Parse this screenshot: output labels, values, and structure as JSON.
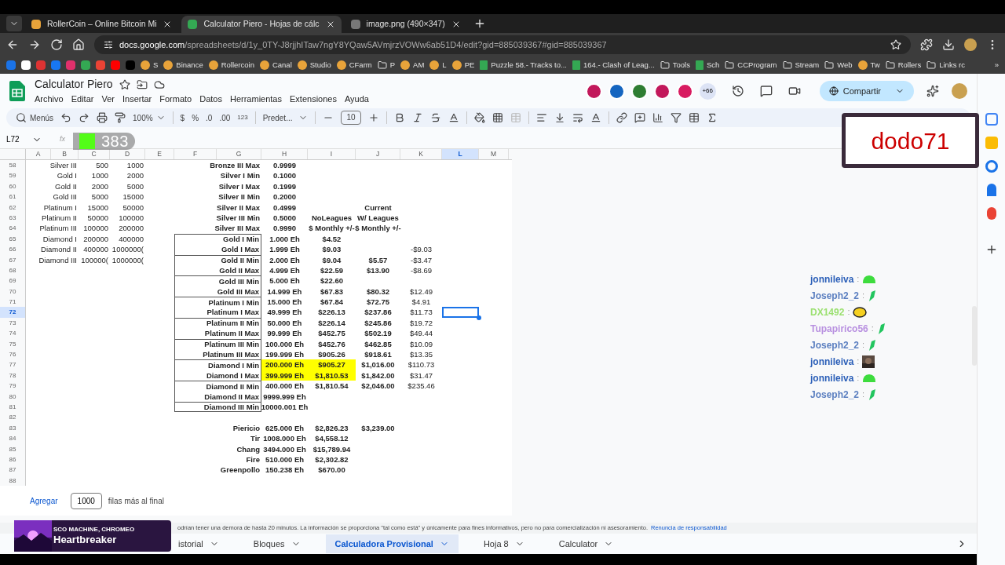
{
  "browser": {
    "tabs": [
      {
        "title": "RollerCoin – Online Bitcoin Mi",
        "selected": false
      },
      {
        "title": "Calculator Piero - Hojas de cálc",
        "selected": true
      },
      {
        "title": "image.png (490×347)",
        "selected": false
      }
    ],
    "address": {
      "host": "docs.google.com",
      "path": "/spreadsheets/d/1y_0TY-J8rjjhITaw7ngY8YQaw5AVmjrzVOWw6ab51D4/edit?gid=885039367#gid=885039367"
    },
    "bookmarks": [
      {
        "label": "S",
        "kind": "site"
      },
      {
        "label": "Binance",
        "kind": "site"
      },
      {
        "label": "Rollercoin",
        "kind": "site"
      },
      {
        "label": "Canal",
        "kind": "site"
      },
      {
        "label": "Studio",
        "kind": "site"
      },
      {
        "label": "CFarm",
        "kind": "site"
      },
      {
        "label": "P",
        "kind": "folder"
      },
      {
        "label": "AM",
        "kind": "site"
      },
      {
        "label": "L",
        "kind": "site"
      },
      {
        "label": "PE",
        "kind": "site"
      },
      {
        "label": "Puzzle 58.- Tracks to...",
        "kind": "sheet"
      },
      {
        "label": "164.- Clash of Leag...",
        "kind": "sheet"
      },
      {
        "label": "Tools",
        "kind": "folder"
      },
      {
        "label": "Sch",
        "kind": "sheet"
      },
      {
        "label": "CCProgram",
        "kind": "folder"
      },
      {
        "label": "Stream",
        "kind": "folder"
      },
      {
        "label": "Web",
        "kind": "folder"
      },
      {
        "label": "Tw",
        "kind": "site"
      },
      {
        "label": "Rollers",
        "kind": "folder"
      },
      {
        "label": "Links rc",
        "kind": "folder"
      }
    ],
    "more": "»"
  },
  "sheet": {
    "title": "Calculator Piero",
    "menu": [
      "Archivo",
      "Editar",
      "Ver",
      "Insertar",
      "Formato",
      "Datos",
      "Herramientas",
      "Extensiones",
      "Ayuda"
    ],
    "collaborators_more": "+66",
    "share": "Compartir",
    "toolbar": {
      "menus": "Menús",
      "zoom": "100%",
      "currency": "$",
      "percent": "%",
      "decrease_decimals": ".0",
      "increase_decimals": ".00",
      "number_format": "123",
      "font": "Predet...",
      "font_size": "10"
    },
    "name_box": "L72",
    "formula_label": "fx",
    "columns": [
      {
        "label": "A",
        "selected": false
      },
      {
        "label": "B",
        "selected": false
      },
      {
        "label": "C",
        "selected": false
      },
      {
        "label": "D",
        "selected": false
      },
      {
        "label": "E",
        "selected": false
      },
      {
        "label": "F",
        "selected": false
      },
      {
        "label": "G",
        "selected": false
      },
      {
        "label": "H",
        "selected": false
      },
      {
        "label": "I",
        "selected": false
      },
      {
        "label": "J",
        "selected": false
      },
      {
        "label": "K",
        "selected": false
      },
      {
        "label": "L",
        "selected": true
      },
      {
        "label": "M",
        "selected": false
      }
    ],
    "rows": [
      {
        "num": "58",
        "selected": false,
        "highlighted": false,
        "boxed": false,
        "cells": {
          "B": "Silver III",
          "C": "500",
          "D": "1000",
          "G": "Bronze III Max",
          "H": "0.9999"
        }
      },
      {
        "num": "59",
        "selected": false,
        "highlighted": false,
        "boxed": false,
        "cells": {
          "B": "Gold I",
          "C": "1000",
          "D": "2000",
          "G": "Silver I Min",
          "H": "0.1000"
        }
      },
      {
        "num": "60",
        "selected": false,
        "highlighted": false,
        "boxed": false,
        "cells": {
          "B": "Gold II",
          "C": "2000",
          "D": "5000",
          "G": "Silver I Max",
          "H": "0.1999"
        }
      },
      {
        "num": "61",
        "selected": false,
        "highlighted": false,
        "boxed": false,
        "cells": {
          "B": "Gold III",
          "C": "5000",
          "D": "15000",
          "G": "Silver II Min",
          "H": "0.2000"
        }
      },
      {
        "num": "62",
        "selected": false,
        "highlighted": false,
        "boxed": false,
        "cells": {
          "B": "Platinum I",
          "C": "15000",
          "D": "50000",
          "G": "Silver II Max",
          "H": "0.4999",
          "J": "Current"
        }
      },
      {
        "num": "63",
        "selected": false,
        "highlighted": false,
        "boxed": false,
        "cells": {
          "B": "Platinum II",
          "C": "50000",
          "D": "100000",
          "G": "Silver III Min",
          "H": "0.5000",
          "I": "NoLeagues",
          "J": "W/ Leagues"
        }
      },
      {
        "num": "64",
        "selected": false,
        "highlighted": false,
        "boxed": false,
        "cells": {
          "B": "Platinum III",
          "C": "100000",
          "D": "200000",
          "G": "Silver III Max",
          "H": "0.9990",
          "I": "$ Monthly +/-",
          "J": "$ Monthly +/-"
        }
      },
      {
        "num": "65",
        "selected": false,
        "highlighted": false,
        "boxed": true,
        "cells": {
          "B": "Diamond I",
          "C": "200000",
          "D": "400000",
          "G": "Gold I Min",
          "H": "1.000 Eh",
          "I": "$4.52"
        }
      },
      {
        "num": "66",
        "selected": false,
        "highlighted": false,
        "boxed": true,
        "cells": {
          "B": "Diamond II",
          "C": "400000",
          "D": "1000000(",
          "G": "Gold I Max",
          "H": "1.999 Eh",
          "I": "$9.03",
          "K": "-$9.03"
        }
      },
      {
        "num": "67",
        "selected": false,
        "highlighted": false,
        "boxed": true,
        "cells": {
          "B": "Diamond III",
          "C": "100000(",
          "D": "1000000(",
          "G": "Gold II Min",
          "H": "2.000 Eh",
          "I": "$9.04",
          "J": "$5.57",
          "K": "-$3.47"
        }
      },
      {
        "num": "68",
        "selected": false,
        "highlighted": false,
        "boxed": true,
        "cells": {
          "G": "Gold II Max",
          "H": "4.999 Eh",
          "I": "$22.59",
          "J": "$13.90",
          "K": "-$8.69"
        }
      },
      {
        "num": "69",
        "selected": false,
        "highlighted": false,
        "boxed": true,
        "cells": {
          "G": "Gold III Min",
          "H": "5.000 Eh",
          "I": "$22.60"
        }
      },
      {
        "num": "70",
        "selected": false,
        "highlighted": false,
        "boxed": true,
        "cells": {
          "G": "Gold III Max",
          "H": "14.999 Eh",
          "I": "$67.83",
          "J": "$80.32",
          "K": "$12.49"
        }
      },
      {
        "num": "71",
        "selected": false,
        "highlighted": false,
        "boxed": true,
        "cells": {
          "G": "Platinum I Min",
          "H": "15.000 Eh",
          "I": "$67.84",
          "J": "$72.75",
          "K": "$4.91"
        }
      },
      {
        "num": "72",
        "selected": true,
        "highlighted": false,
        "boxed": true,
        "cells": {
          "G": "Platinum I Max",
          "H": "49.999 Eh",
          "I": "$226.13",
          "J": "$237.86",
          "K": "$11.73"
        }
      },
      {
        "num": "73",
        "selected": false,
        "highlighted": false,
        "boxed": true,
        "cells": {
          "G": "Platinum II Min",
          "H": "50.000 Eh",
          "I": "$226.14",
          "J": "$245.86",
          "K": "$19.72"
        }
      },
      {
        "num": "74",
        "selected": false,
        "highlighted": false,
        "boxed": true,
        "cells": {
          "G": "Platinum II Max",
          "H": "99.999 Eh",
          "I": "$452.75",
          "J": "$502.19",
          "K": "$49.44"
        }
      },
      {
        "num": "75",
        "selected": false,
        "highlighted": false,
        "boxed": true,
        "cells": {
          "G": "Platinum III Min",
          "H": "100.000 Eh",
          "I": "$452.76",
          "J": "$462.85",
          "K": "$10.09"
        }
      },
      {
        "num": "76",
        "selected": false,
        "highlighted": false,
        "boxed": true,
        "cells": {
          "G": "Platinum III Max",
          "H": "199.999 Eh",
          "I": "$905.26",
          "J": "$918.61",
          "K": "$13.35"
        }
      },
      {
        "num": "77",
        "selected": false,
        "highlighted": true,
        "boxed": true,
        "cells": {
          "G": "Diamond I Min",
          "H": "200.000 Eh",
          "I": "$905.27",
          "J": "$1,016.00",
          "K": "$110.73"
        }
      },
      {
        "num": "78",
        "selected": false,
        "highlighted": true,
        "boxed": true,
        "cells": {
          "G": "Diamond I Max",
          "H": "399.999 Eh",
          "I": "$1,810.53",
          "J": "$1,842.00",
          "K": "$31.47"
        }
      },
      {
        "num": "79",
        "selected": false,
        "highlighted": false,
        "boxed": true,
        "cells": {
          "G": "Diamond II Min",
          "H": "400.000 Eh",
          "I": "$1,810.54",
          "J": "$2,046.00",
          "K": "$235.46"
        }
      },
      {
        "num": "80",
        "selected": false,
        "highlighted": false,
        "boxed": true,
        "cells": {
          "G": "Diamond II Max",
          "H": "9999.999 Eh"
        }
      },
      {
        "num": "81",
        "selected": false,
        "highlighted": false,
        "boxed": true,
        "cells": {
          "G": "Diamond III Min",
          "H": "10000.001 Eh"
        }
      },
      {
        "num": "82",
        "selected": false,
        "highlighted": false,
        "boxed": false,
        "cells": {}
      },
      {
        "num": "83",
        "selected": false,
        "highlighted": false,
        "boxed": false,
        "cells": {
          "G": "Piericio",
          "H": "625.000 Eh",
          "I": "$2,826.23",
          "J": "$3,239.00"
        }
      },
      {
        "num": "84",
        "selected": false,
        "highlighted": false,
        "boxed": false,
        "cells": {
          "G": "Tir",
          "H": "1008.000 Eh",
          "I": "$4,558.12"
        }
      },
      {
        "num": "85",
        "selected": false,
        "highlighted": false,
        "boxed": false,
        "cells": {
          "G": "Chang",
          "H": "3494.000 Eh",
          "I": "$15,789.94"
        }
      },
      {
        "num": "86",
        "selected": false,
        "highlighted": false,
        "boxed": false,
        "cells": {
          "G": "Fire",
          "H": "510.000 Eh",
          "I": "$2,302.82"
        }
      },
      {
        "num": "87",
        "selected": false,
        "highlighted": false,
        "boxed": false,
        "cells": {
          "G": "Greenpollo",
          "H": "150.238 Eh",
          "I": "$670.00"
        }
      },
      {
        "num": "88",
        "selected": false,
        "highlighted": false,
        "boxed": false,
        "cells": {}
      }
    ],
    "add_rows": {
      "button": "Agregar",
      "value": "1000",
      "suffix": "filas más al final"
    },
    "disclaimer": {
      "text": "odrían tener una demora de hasta 20 minutos. La información se proporciona \"tal como está\" y únicamente para fines informativos, pero no para comercialización ni asesoramiento.",
      "link": "Renuncia de responsabilidad"
    },
    "sheet_tabs": [
      {
        "label": "istorial",
        "selected": false
      },
      {
        "label": "Bloques",
        "selected": false
      },
      {
        "label": "Calculadora Provisional",
        "selected": true
      },
      {
        "label": "Hoja 8",
        "selected": false
      },
      {
        "label": "Calculator",
        "selected": false
      }
    ]
  },
  "overlays": {
    "counter": "383",
    "streamer": "dodo71",
    "now_playing": {
      "artist": "SCO MACHINE, CHROMEO",
      "title": "Heartbreaker"
    },
    "chat": [
      {
        "user": "jonnileiva",
        "separator": ":",
        "color": "#2b5fb8",
        "kind": "blob"
      },
      {
        "user": "Joseph2_2",
        "separator": ":",
        "color": "#5b7fc0",
        "kind": "sprout"
      },
      {
        "user": "DX1492",
        "separator": ":",
        "color": "#9be070",
        "kind": "bee"
      },
      {
        "user": "Tupapirico56",
        "separator": ":",
        "color": "#b890e0",
        "kind": "sprout"
      },
      {
        "user": "Joseph2_2",
        "separator": ":",
        "color": "#5b7fc0",
        "kind": "sprout"
      },
      {
        "user": "jonnileiva",
        "separator": ":",
        "color": "#2b5fb8"
      },
      {
        "user": "jonnileiva",
        "separator": ":",
        "color": "#2b5fb8",
        "kind": "blob"
      },
      {
        "user": "Joseph2_2",
        "separator": ":",
        "color": "#5b7fc0",
        "kind": "sprout"
      }
    ]
  }
}
